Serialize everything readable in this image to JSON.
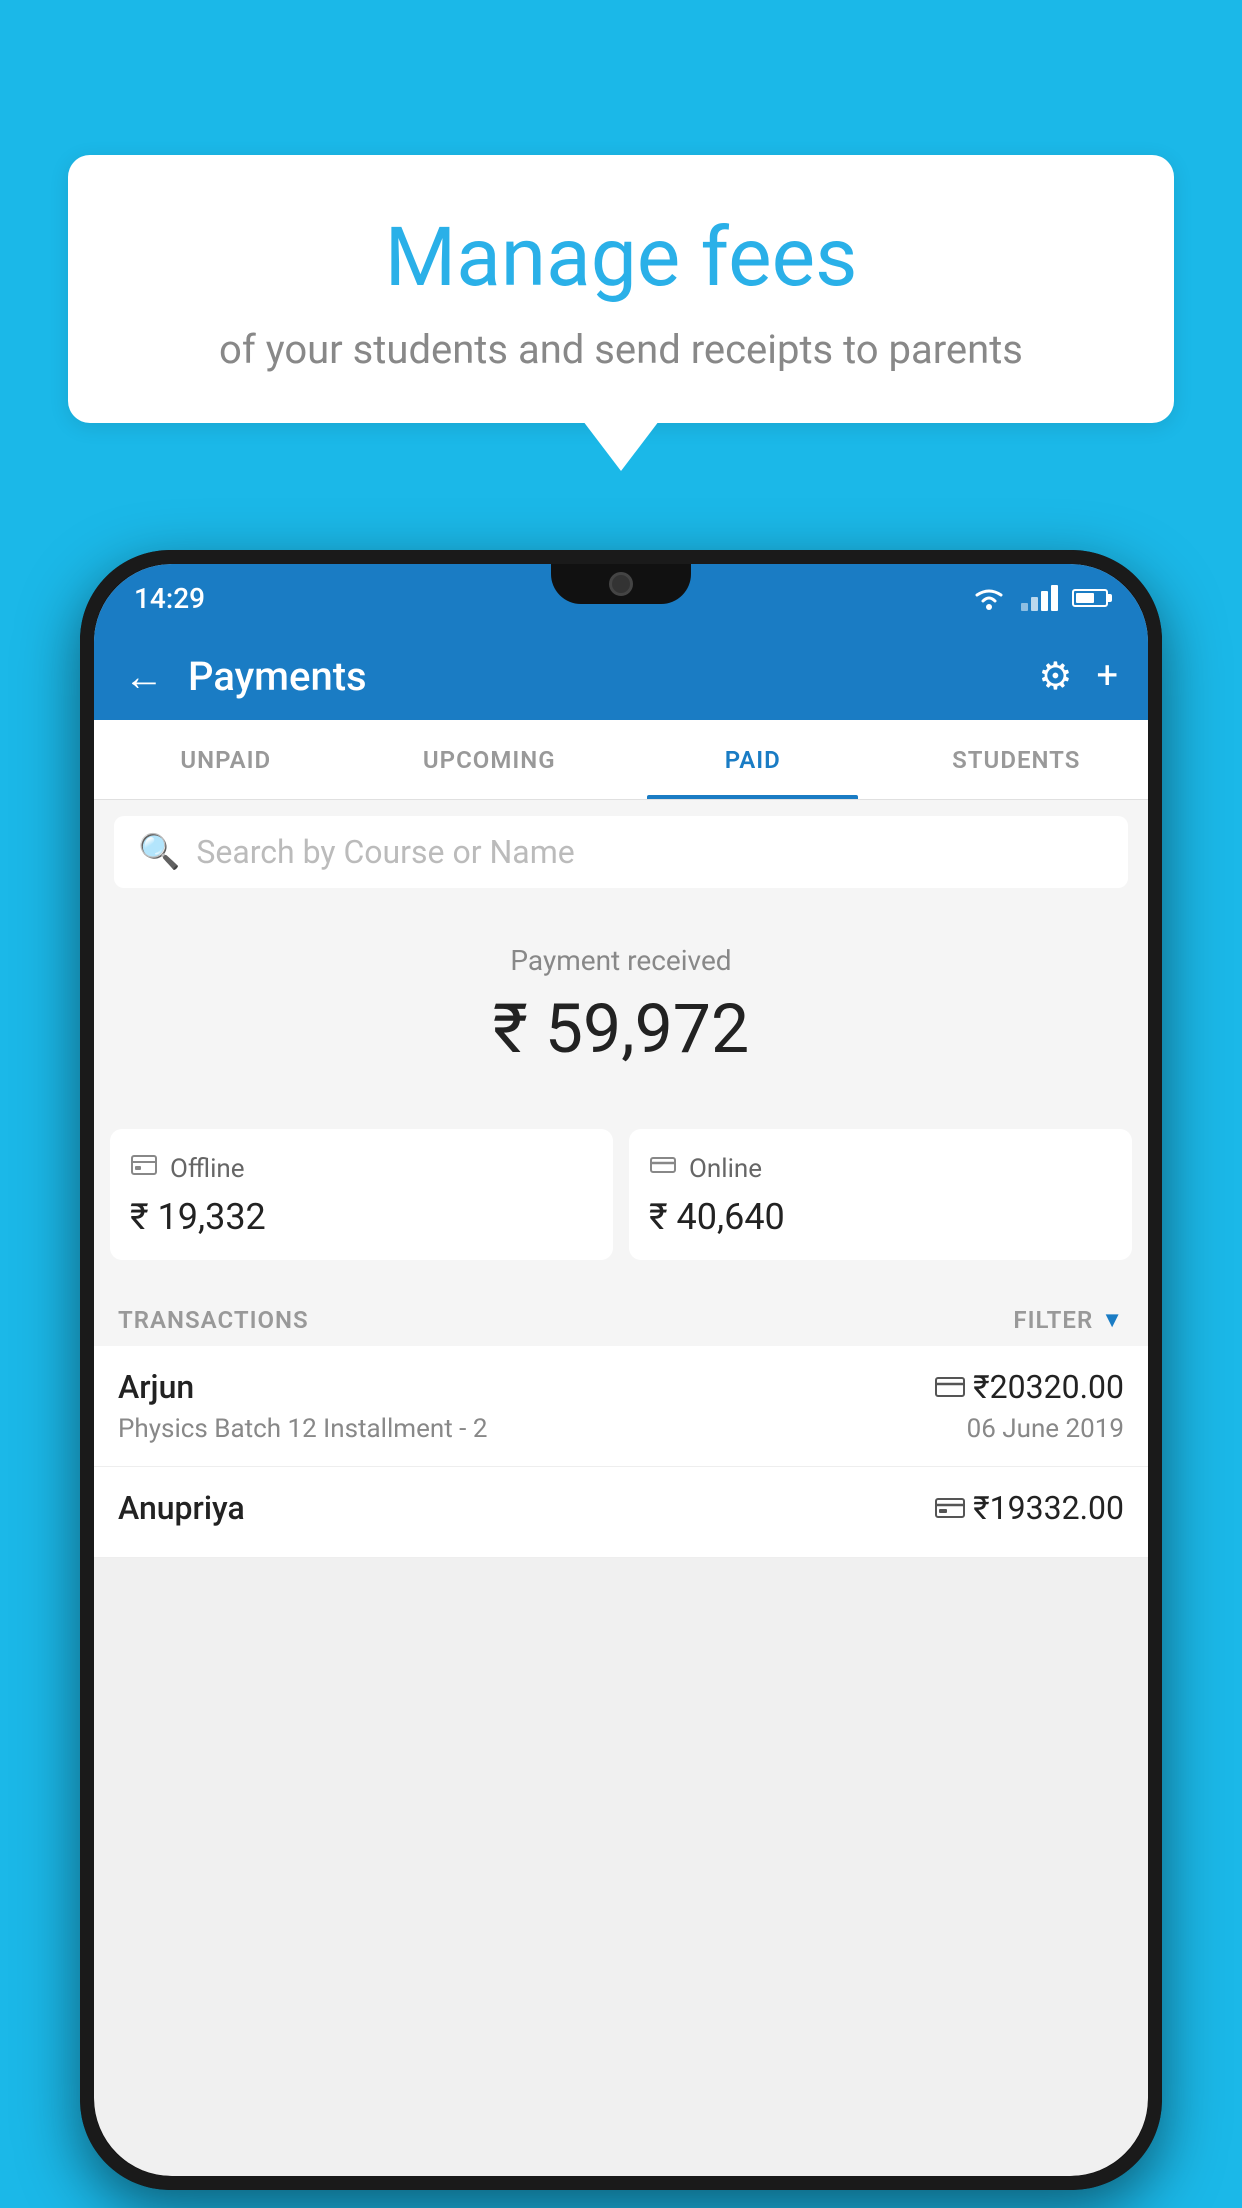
{
  "page": {
    "bg_color": "#1bb8e8"
  },
  "speech_bubble": {
    "heading": "Manage fees",
    "subtext": "of your students and send receipts to parents"
  },
  "status_bar": {
    "time": "14:29"
  },
  "app_bar": {
    "title": "Payments",
    "back_label": "←",
    "gear_label": "⚙",
    "plus_label": "+"
  },
  "tabs": [
    {
      "label": "UNPAID",
      "active": false
    },
    {
      "label": "UPCOMING",
      "active": false
    },
    {
      "label": "PAID",
      "active": true
    },
    {
      "label": "STUDENTS",
      "active": false
    }
  ],
  "search": {
    "placeholder": "Search by Course or Name"
  },
  "payment_summary": {
    "label": "Payment received",
    "amount": "₹ 59,972",
    "offline_label": "Offline",
    "offline_amount": "₹ 19,332",
    "online_label": "Online",
    "online_amount": "₹ 40,640"
  },
  "transactions": {
    "header": "TRANSACTIONS",
    "filter_label": "FILTER",
    "rows": [
      {
        "name": "Arjun",
        "amount": "₹20320.00",
        "course": "Physics Batch 12 Installment - 2",
        "date": "06 June 2019",
        "payment_type": "online"
      },
      {
        "name": "Anupriya",
        "amount": "₹19332.00",
        "course": "",
        "date": "",
        "payment_type": "offline"
      }
    ]
  }
}
